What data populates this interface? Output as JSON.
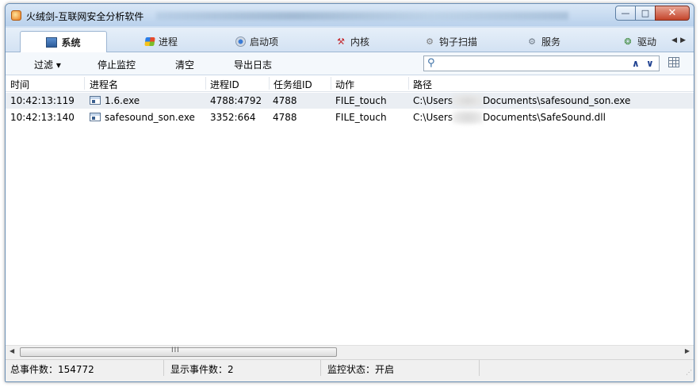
{
  "window": {
    "title": "火绒剑-互联网安全分析软件",
    "buttons": {
      "minimize": "—",
      "maximize": "□",
      "close": "✕"
    }
  },
  "tabs": [
    {
      "label": "系统",
      "icon": "monitor-icon"
    },
    {
      "label": "进程",
      "icon": "windows-flag-icon"
    },
    {
      "label": "启动项",
      "icon": "startup-icon"
    },
    {
      "label": "内核",
      "icon": "kernel-icon"
    },
    {
      "label": "钩子扫描",
      "icon": "hook-scan-icon"
    },
    {
      "label": "服务",
      "icon": "service-icon"
    },
    {
      "label": "驱动",
      "icon": "driver-icon"
    }
  ],
  "toolbar": {
    "filter": "过滤 ▾",
    "stop_monitor": "停止监控",
    "clear": "清空",
    "export_log": "导出日志"
  },
  "columns": [
    "时间",
    "进程名",
    "进程ID",
    "任务组ID",
    "动作",
    "路径"
  ],
  "rows": [
    {
      "time": "10:42:13:119",
      "process": "1.6.exe",
      "pid": "4788:4792",
      "group": "4788",
      "action": "FILE_touch",
      "path_prefix": "C:\\Users",
      "path_suffix": "Documents\\safesound_son.exe"
    },
    {
      "time": "10:42:13:140",
      "process": "safesound_son.exe",
      "pid": "3352:664",
      "group": "4788",
      "action": "FILE_touch",
      "path_prefix": "C:\\Users",
      "path_suffix": "Documents\\SafeSound.dll"
    }
  ],
  "scrollbar": {
    "grip": "III"
  },
  "status": {
    "total": "总事件数：154772",
    "shown": "显示事件数：2",
    "monitor": "监控状态：开启"
  },
  "colors": {
    "accent": "#1d3f8f",
    "selected_row": "#eaeef3"
  }
}
